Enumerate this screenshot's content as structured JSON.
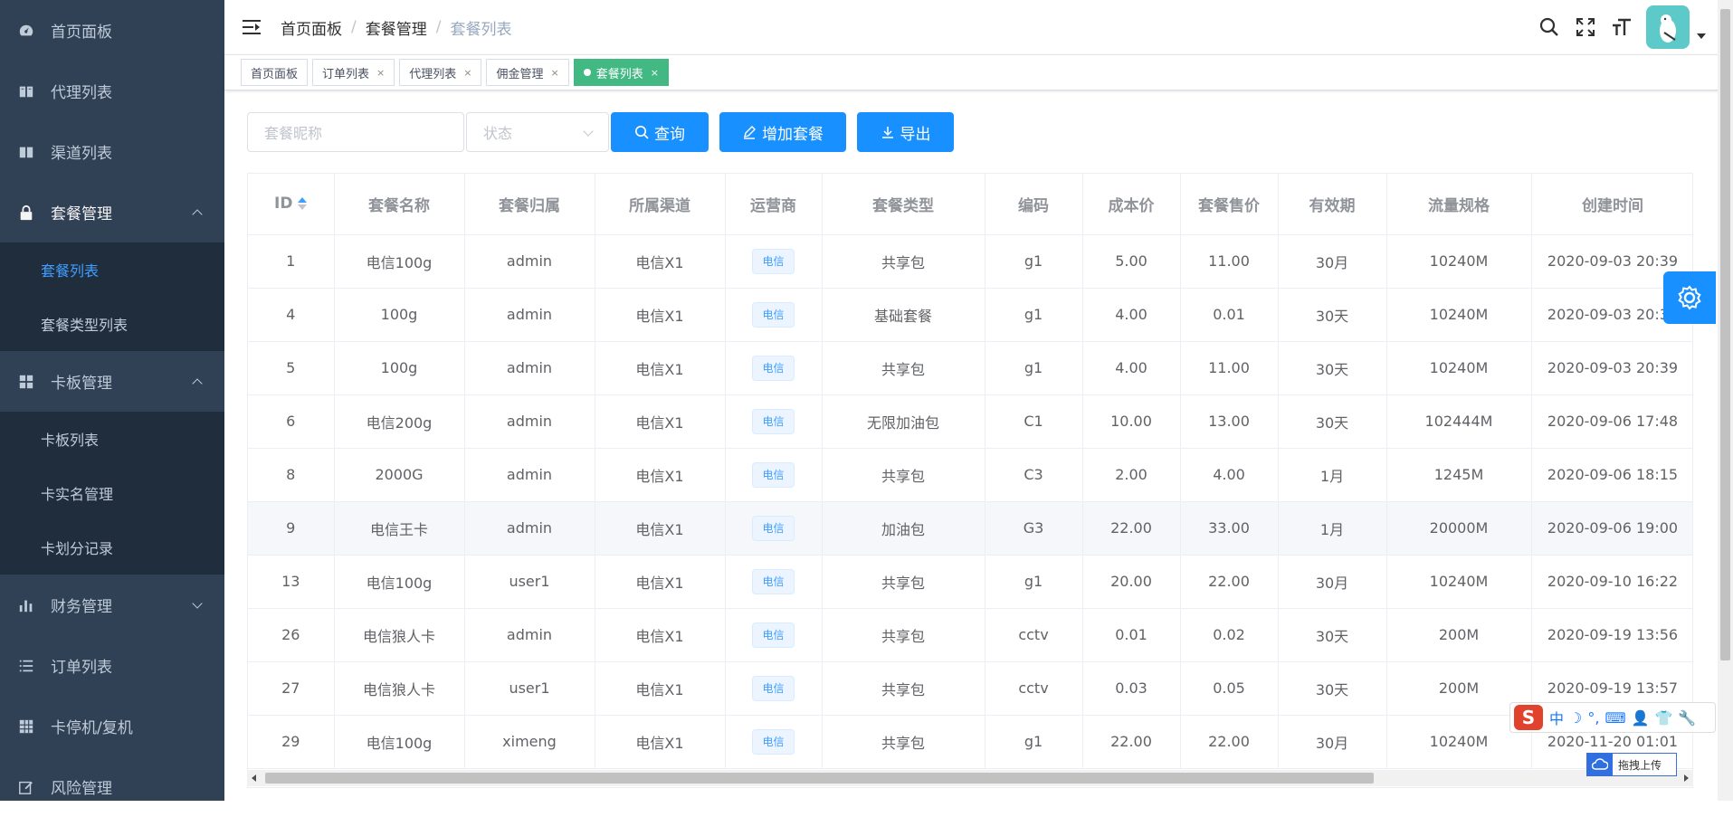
{
  "sidebar": {
    "items": [
      {
        "label": "首页面板",
        "icon": "dashboard-icon"
      },
      {
        "label": "代理列表",
        "icon": "book-icon"
      },
      {
        "label": "渠道列表",
        "icon": "book-icon"
      },
      {
        "label": "套餐管理",
        "icon": "lock-icon",
        "expanded": true,
        "children": [
          {
            "label": "套餐列表",
            "active": true
          },
          {
            "label": "套餐类型列表"
          }
        ]
      },
      {
        "label": "卡板管理",
        "icon": "grid-icon",
        "expanded": true,
        "children": [
          {
            "label": "卡板列表"
          },
          {
            "label": "卡实名管理"
          },
          {
            "label": "卡划分记录"
          }
        ]
      },
      {
        "label": "财务管理",
        "icon": "chart-icon",
        "expanded": false
      },
      {
        "label": "订单列表",
        "icon": "list-icon"
      },
      {
        "label": "卡停机/复机",
        "icon": "table-icon"
      },
      {
        "label": "风险管理",
        "icon": "edit-icon"
      }
    ]
  },
  "breadcrumb": [
    "首页面板",
    "套餐管理",
    "套餐列表"
  ],
  "tags": [
    {
      "label": "首页面板"
    },
    {
      "label": "订单列表",
      "close": "×"
    },
    {
      "label": "代理列表",
      "close": "×"
    },
    {
      "label": "佣金管理",
      "close": "×"
    },
    {
      "label": "套餐列表",
      "close": "×",
      "active": true
    }
  ],
  "filters": {
    "name_placeholder": "套餐昵称",
    "status_placeholder": "状态",
    "query_label": "查询",
    "add_label": "增加套餐",
    "export_label": "导出"
  },
  "table": {
    "columns": [
      "ID",
      "套餐名称",
      "套餐归属",
      "所属渠道",
      "运营商",
      "套餐类型",
      "编码",
      "成本价",
      "套餐售价",
      "有效期",
      "流量规格",
      "创建时间"
    ],
    "rows": [
      [
        "1",
        "电信100g",
        "admin",
        "电信X1",
        "电信",
        "共享包",
        "g1",
        "5.00",
        "11.00",
        "30月",
        "10240M",
        "2020-09-03 20:39"
      ],
      [
        "4",
        "100g",
        "admin",
        "电信X1",
        "电信",
        "基础套餐",
        "g1",
        "4.00",
        "0.01",
        "30天",
        "10240M",
        "2020-09-03 20:39"
      ],
      [
        "5",
        "100g",
        "admin",
        "电信X1",
        "电信",
        "共享包",
        "g1",
        "4.00",
        "11.00",
        "30天",
        "10240M",
        "2020-09-03 20:39"
      ],
      [
        "6",
        "电信200g",
        "admin",
        "电信X1",
        "电信",
        "无限加油包",
        "C1",
        "10.00",
        "13.00",
        "30天",
        "102444M",
        "2020-09-06 17:48"
      ],
      [
        "8",
        "2000G",
        "admin",
        "电信X1",
        "电信",
        "共享包",
        "C3",
        "2.00",
        "4.00",
        "1月",
        "1245M",
        "2020-09-06 18:15"
      ],
      [
        "9",
        "电信王卡",
        "admin",
        "电信X1",
        "电信",
        "加油包",
        "G3",
        "22.00",
        "33.00",
        "1月",
        "20000M",
        "2020-09-06 19:00"
      ],
      [
        "13",
        "电信100g",
        "user1",
        "电信X1",
        "电信",
        "共享包",
        "g1",
        "20.00",
        "22.00",
        "30月",
        "10240M",
        "2020-09-10 16:22"
      ],
      [
        "26",
        "电信狼人卡",
        "admin",
        "电信X1",
        "电信",
        "共享包",
        "cctv",
        "0.01",
        "0.02",
        "30天",
        "200M",
        "2020-09-19 13:56"
      ],
      [
        "27",
        "电信狼人卡",
        "user1",
        "电信X1",
        "电信",
        "共享包",
        "cctv",
        "0.03",
        "0.05",
        "30天",
        "200M",
        "2020-09-19 13:57"
      ],
      [
        "29",
        "电信100g",
        "ximeng",
        "电信X1",
        "电信",
        "共享包",
        "g1",
        "22.00",
        "22.00",
        "30月",
        "10240M",
        "2020-11-20 01:01"
      ]
    ]
  },
  "ime": {
    "logo": "S",
    "items": [
      "中",
      "☽",
      "°,",
      "⌨",
      "👤",
      "👕",
      "🔧"
    ]
  },
  "upload": {
    "label": "拖拽上传"
  },
  "colors": {
    "sidebar_bg": "#304156",
    "submenu_bg": "#1f2d3d",
    "primary": "#1890ff",
    "active_tag": "#42b983"
  }
}
